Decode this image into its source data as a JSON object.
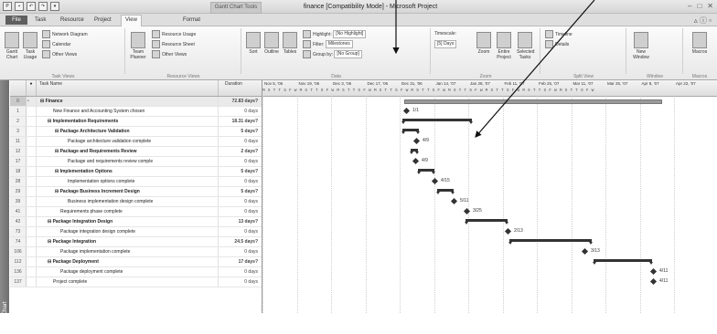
{
  "window": {
    "title": "finance [Compatibility Mode] - Microsoft Project",
    "contextual_tab": "Gantt Chart Tools"
  },
  "tabs": [
    "File",
    "Task",
    "Resource",
    "Project",
    "View",
    "Format"
  ],
  "ribbon": {
    "groups": {
      "task_views": "Task Views",
      "resource_views": "Resource Views",
      "data": "Data",
      "zoom": "Zoom",
      "split_view": "Split View",
      "window": "Window",
      "macros": "Macros"
    },
    "buttons": {
      "gantt_chart": "Gantt Chart",
      "task_usage": "Task Usage",
      "network_diagram": "Network Diagram",
      "calendar": "Calendar",
      "other_views": "Other Views",
      "team_planner": "Team Planner",
      "resource_usage": "Resource Usage",
      "resource_sheet": "Resource Sheet",
      "other_views_res": "Other Views",
      "sort": "Sort",
      "outline": "Outline",
      "tables": "Tables",
      "highlight": "Highlight:",
      "highlight_value": "[No Highlight]",
      "filter": "Filter:",
      "filter_value": "Milestones",
      "group_by": "Group by:",
      "group_value": "[No Group]",
      "timescale": "Timescale:",
      "timescale_value": "[5] Days",
      "zoom": "Zoom",
      "entire_project": "Entire Project",
      "selected_tasks": "Selected Tasks",
      "timeline": "Timeline",
      "details": "Details",
      "new_window": "New Window",
      "macros": "Macros"
    }
  },
  "viewbar_label": "Gantt Chart",
  "grid": {
    "headers": {
      "id": "",
      "indicators": "",
      "name": "Task Name",
      "duration": "Duration"
    },
    "rows": [
      {
        "id": "0",
        "name": "Finance",
        "duration": "72.83 days?",
        "level": 0,
        "summary": true
      },
      {
        "id": "1",
        "name": "New Finance and Accounting System chosen",
        "duration": "0 days",
        "level": 1,
        "summary": false
      },
      {
        "id": "2",
        "name": "Implementation Requirements",
        "duration": "18.31 days?",
        "level": 1,
        "summary": true
      },
      {
        "id": "3",
        "name": "Package Architecture Validation",
        "duration": "5 days?",
        "level": 2,
        "summary": true
      },
      {
        "id": "11",
        "name": "Package architecture validation complete",
        "duration": "0 days",
        "level": 3,
        "summary": false
      },
      {
        "id": "12",
        "name": "Package and Requirements Review",
        "duration": "2 days?",
        "level": 2,
        "summary": true
      },
      {
        "id": "17",
        "name": "Package and requirements review comple",
        "duration": "0 days",
        "level": 3,
        "summary": false
      },
      {
        "id": "18",
        "name": "Implementation Options",
        "duration": "5 days?",
        "level": 2,
        "summary": true
      },
      {
        "id": "28",
        "name": "Implementation options complete",
        "duration": "0 days",
        "level": 3,
        "summary": false
      },
      {
        "id": "29",
        "name": "Package Business Increment Design",
        "duration": "5 days?",
        "level": 2,
        "summary": true
      },
      {
        "id": "39",
        "name": "Business implementation design complete",
        "duration": "0 days",
        "level": 3,
        "summary": false
      },
      {
        "id": "41",
        "name": "Requirements phase complete",
        "duration": "0 days",
        "level": 2,
        "summary": false
      },
      {
        "id": "42",
        "name": "Package Integration Design",
        "duration": "13 days?",
        "level": 1,
        "summary": true
      },
      {
        "id": "73",
        "name": "Package integration design complete",
        "duration": "0 days",
        "level": 2,
        "summary": false
      },
      {
        "id": "74",
        "name": "Package Integration",
        "duration": "24.5 days?",
        "level": 1,
        "summary": true
      },
      {
        "id": "106",
        "name": "Package implementation complete",
        "duration": "0 days",
        "level": 2,
        "summary": false
      },
      {
        "id": "112",
        "name": "Package Deployment",
        "duration": "17 days?",
        "level": 1,
        "summary": true
      },
      {
        "id": "136",
        "name": "Package deployment complete",
        "duration": "0 days",
        "level": 2,
        "summary": false
      },
      {
        "id": "137",
        "name": "Project complete",
        "duration": "0 days",
        "level": 1,
        "summary": false
      }
    ]
  },
  "timescale": {
    "weeks": [
      "Nov 5, '06",
      "Nov 19, '06",
      "Dec 3, '06",
      "Dec 17, '06",
      "Dec 31, '06",
      "Jan 14, '07",
      "Jan 28, '07",
      "Feb 11, '07",
      "Feb 25, '07",
      "Mar 11, '07",
      "Mar 25, '07",
      "Apr 8, '07",
      "Apr 22, '07"
    ],
    "day_letters": "M S T T S F W M S T T S F W M S T T S F W M S T T S F W M S T T S F W M S T T S F W M S T T S F W M S T T S F W M S T T S F W"
  },
  "milestone_labels": [
    "1/1",
    "4/9",
    "4/9",
    "4/15",
    "5/11",
    "3/25",
    "2/13",
    "3/13",
    "4/11",
    "4/11"
  ]
}
